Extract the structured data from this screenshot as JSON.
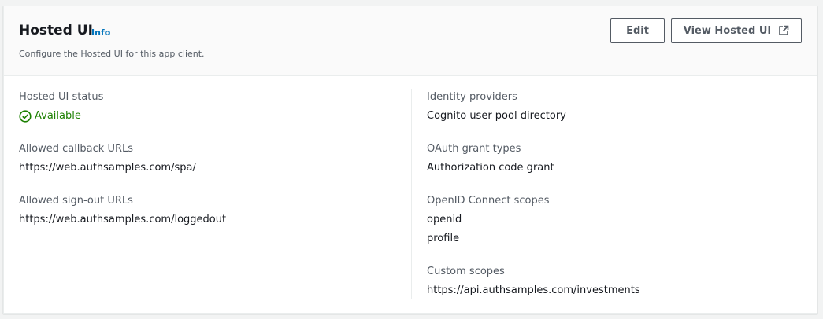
{
  "header": {
    "title": "Hosted UI",
    "info": "Info",
    "description": "Configure the Hosted UI for this app client.",
    "edit_label": "Edit",
    "view_label": "View Hosted UI"
  },
  "left": {
    "status_label": "Hosted UI status",
    "status_value": "Available",
    "callback_label": "Allowed callback URLs",
    "callback_value": "https://web.authsamples.com/spa/",
    "signout_label": "Allowed sign-out URLs",
    "signout_value": "https://web.authsamples.com/loggedout"
  },
  "right": {
    "idp_label": "Identity providers",
    "idp_value": "Cognito user pool directory",
    "oauth_label": "OAuth grant types",
    "oauth_value": "Authorization code grant",
    "oidc_label": "OpenID Connect scopes",
    "oidc_values": [
      "openid",
      "profile"
    ],
    "custom_label": "Custom scopes",
    "custom_value": "https://api.authsamples.com/investments"
  },
  "colors": {
    "accent_link": "#0073bb",
    "success": "#1d8102",
    "text_primary": "#16191f",
    "text_secondary": "#545b64"
  },
  "icons": {
    "status": "check-circle-icon",
    "view": "external-link-icon"
  }
}
